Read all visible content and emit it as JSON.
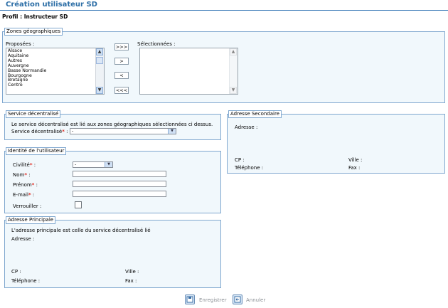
{
  "page": {
    "title": "Création utilisateur SD",
    "profile": "Profil : Instructeur SD"
  },
  "zones": {
    "legend": "Zones géographiques",
    "proposed_label": "Proposées :",
    "selected_label": "Sélectionnées :",
    "proposed": [
      "Alsace",
      "Aquitaine",
      "Autres",
      "Auvergne",
      "Basse Normandie",
      "Bourgogne",
      "Bretagne",
      "Centre"
    ],
    "selected": [],
    "buttons": {
      "add_all": ">>>",
      "add": ">",
      "remove": "<",
      "remove_all": "<<<"
    }
  },
  "service": {
    "legend": "Service décentralisé",
    "note": "Le service décentralisé est lié aux zones géographiques sélectionnées ci dessus.",
    "label": "Service décentralisé",
    "value": "-"
  },
  "identity": {
    "legend": "Identité de l'utilisateur",
    "civility_label": "Civilité",
    "civility_value": "-",
    "nom_label": "Nom",
    "prenom_label": "Prénom",
    "email_label": "E-mail",
    "lock_label": "Verrouiller :"
  },
  "required_mark": "*",
  "colon": ":",
  "main_address": {
    "legend": "Adresse Principale",
    "note": "L'adresse principale est celle du service décentralisé lié",
    "address_label": "Adresse :",
    "cp_label": "CP :",
    "ville_label": "Ville :",
    "phone_label": "Téléphone :",
    "fax_label": "Fax :"
  },
  "secondary_address": {
    "legend": "Adresse Secondaire",
    "address_label": "Adresse :",
    "cp_label": "CP :",
    "ville_label": "Ville :",
    "phone_label": "Téléphone :",
    "fax_label": "Fax :"
  },
  "footer": {
    "save_label": "Enregistrer",
    "cancel_label": "Annuler"
  },
  "colors": {
    "title": "#2c6ea6",
    "fieldset_bg": "#f1f8fc",
    "border": "#7fa7cf",
    "required": "#e0281e"
  }
}
